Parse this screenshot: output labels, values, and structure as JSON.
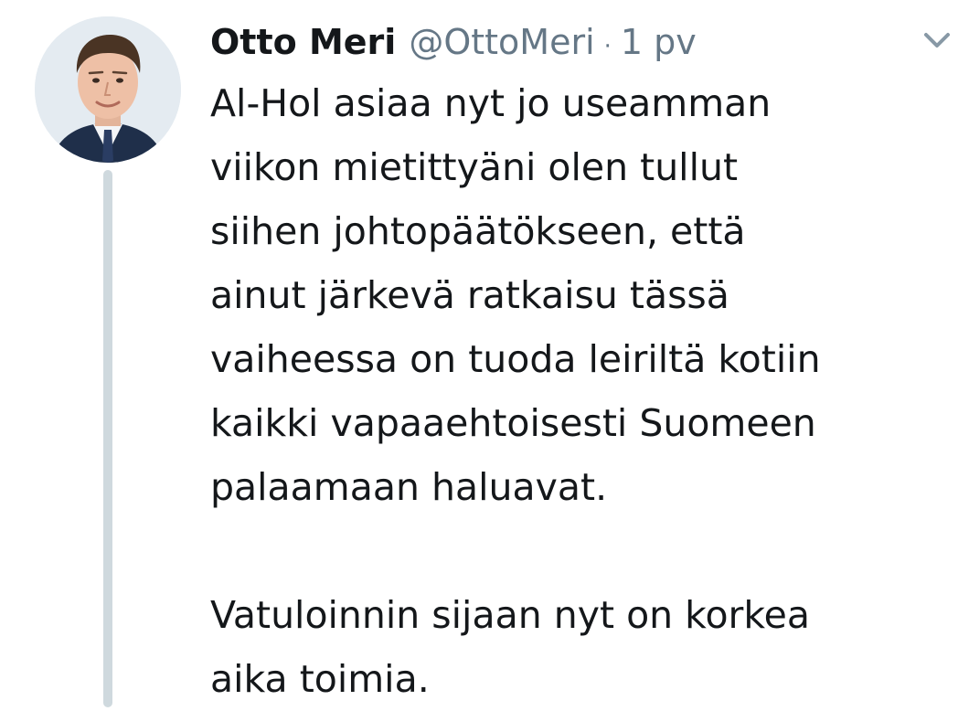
{
  "tweet": {
    "display_name": "Otto Meri",
    "handle": "@OttoMeri",
    "separator": "·",
    "time": "1 pv",
    "text": "Al-Hol asiaa nyt jo useamman\nviikon mietittyäni olen tullut\nsiihen johtopäätökseen, että\nainut järkevä ratkaisu tässä\nvaiheessa on tuoda leiriltä kotiin\nkaikki vapaaehtoisesti Suomeen\npalaamaan haluavat.\n\nVatuloinnin sijaan nyt on korkea\naika toimia.",
    "avatar_icon": "profile-photo",
    "menu_icon": "chevron-down-icon"
  },
  "colors": {
    "text": "#14171a",
    "secondary": "#657786",
    "thread_line": "#cfd9de"
  }
}
